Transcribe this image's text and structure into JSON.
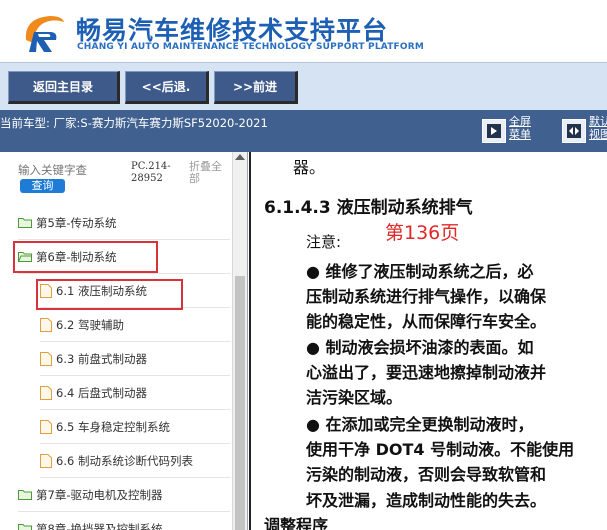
{
  "header": {
    "title_cn": "畅易汽车维修技术支持平台",
    "title_en": "CHANG YI AUTO MAINTENANCE TECHNOLOGY SUPPORT PLATFORM"
  },
  "nav": {
    "home": "返回主目录",
    "back": "<<后退.",
    "forward": ">>前进"
  },
  "info": {
    "car_model": "当前车型: 厂家:S-赛力斯汽车赛力斯SF52020-2021",
    "fullscreen_label_1": "全屏",
    "fullscreen_label_2": "菜单",
    "default_label_1": "默认",
    "default_label_2": "视图"
  },
  "sidebar": {
    "search_placeholder": "输入关键字查",
    "search_button": "查询",
    "pc_code": "PC.214-28952",
    "collapse_all": "折叠全部",
    "items": [
      {
        "label": "第5章-传动系统",
        "type": "folder"
      },
      {
        "label": "第6章-制动系统",
        "type": "folder"
      },
      {
        "label": "6.1 液压制动系统",
        "type": "doc"
      },
      {
        "label": "6.2 驾驶辅助",
        "type": "doc"
      },
      {
        "label": "6.3 前盘式制动器",
        "type": "doc"
      },
      {
        "label": "6.4 后盘式制动器",
        "type": "doc"
      },
      {
        "label": "6.5 车身稳定控制系统",
        "type": "doc"
      },
      {
        "label": "6.6 制动系统诊断代码列表",
        "type": "doc"
      },
      {
        "label": "第7章-驱动电机及控制器",
        "type": "folder"
      },
      {
        "label": "第8章-换挡器及控制系统",
        "type": "folder"
      }
    ]
  },
  "content": {
    "top_fragment": "器。",
    "section_title": "6.1.4.3 液压制动系统排气",
    "page_mark": "第136页",
    "note_label": "注意:",
    "lines": [
      "●    维修了液压制动系统之后，必",
      "压制动系统进行排气操作，以确保",
      "能的稳定性，从而保障行车安全。",
      "●    制动液会损坏油漆的表面。如",
      "心溢出了，要迅速地擦掉制动液并",
      "洁污染区域。",
      "●    在添加或完全更换制动液时，",
      "使用干净 DOT4 号制动液。不能使用",
      "污染的制动液，否则会导致软管和",
      "坏及泄漏，造成制动性能的失去。"
    ],
    "bottom_heading": "调整程序"
  }
}
